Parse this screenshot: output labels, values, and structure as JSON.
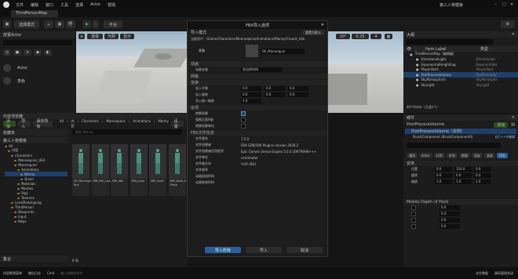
{
  "app": {
    "menu": [
      "文件",
      "编辑",
      "窗口",
      "工具",
      "选择",
      "Actor",
      "帮助"
    ],
    "project": "第三人称模板",
    "tab": "ThirdPersonMap"
  },
  "toolbar": {
    "save": "选择模式",
    "platforms": "平台"
  },
  "viewport_left": {
    "perspective": "透视",
    "lit": "光照",
    "show": "显示"
  },
  "viewport_right": {
    "n1": "10°",
    "n2": "0.25",
    "n3": "4"
  },
  "place_actors": {
    "title": "放置Actor",
    "search_placeholder": "搜索类",
    "items": [
      "Actor",
      "角色"
    ]
  },
  "content_browser": {
    "title": "内容浏览器",
    "add": "添加",
    "import": "导入",
    "save_all": "保存所有",
    "path": [
      "All",
      "内容",
      "Characters",
      "Mannequins",
      "Animations",
      "Manny"
    ],
    "settings": "设置",
    "search_placeholder": "搜索 Manny",
    "favorites": "收藏夹",
    "project": "第三人称模板",
    "tree": [
      "All",
      "内容",
      "Characters",
      "Mannequins_UE4",
      "Mannequins",
      "Animations",
      "Manny",
      "Quinn",
      "Materials",
      "Meshes",
      "Rigs",
      "Textures",
      "LevelPrototyping",
      "ThirdPerson",
      "Blueprints",
      "Input",
      "Maps"
    ],
    "collections": "集合",
    "count": "6 项",
    "assets": [
      "SK_Mannequin_Walk\nRun",
      "MM_Fall_Loop",
      "MM_Idle",
      "MM_Jump",
      "MM_Land",
      "MM_Walk_In\nPlace"
    ]
  },
  "dialog": {
    "title": "FBX导入选项",
    "section_import": "导入模式",
    "reset": "重置为默认",
    "current_asset_label": "当前资产：",
    "current_asset": "/Game/Characters/Mannequins/Animations/Manny/Crouch_Idle",
    "skeleton_label": "骨骼",
    "skeleton_value": "SK_Mannequin",
    "sec_anim": "动画",
    "anim_length_label": "动画长度",
    "anim_length_value": "导出的时间",
    "sec_mesh": "网格",
    "sec_transform": "变换",
    "t1": "导入平移",
    "t2": "导入旋转",
    "t3": "导入统一缩放",
    "v0": "0.0",
    "v1": "1.0",
    "sec_misc": "杂项",
    "m1": "转换场景",
    "m2": "强制正面X轴",
    "m3": "转换场景单位",
    "sec_info": "FBX文件信息",
    "i_ver": "文件版本",
    "i_ver_v": "7.5.0",
    "i_app": "文件创建者",
    "i_app_v": "FBX SDK/FBX Plugins version 2020.2",
    "i_creator": "文件创建者应用程序",
    "i_creator_v": "Epic Games Unreal Engine 5.0.3-20979098+++",
    "i_unit": "文件单位",
    "i_unit_v": "centimeter",
    "i_axis": "文件轴方向",
    "i_axis_v": "Y-UP (RH)",
    "i_time": "文件帧率",
    "i_start": "动画起始时间",
    "i_end": "动画结束时间",
    "import_all": "导入所有",
    "import": "导入",
    "cancel": "取消"
  },
  "outliner": {
    "title": "大纲",
    "col_label": "Item Label",
    "col_type": "类型",
    "rows": [
      {
        "label": "ThirdPersonMap（编辑器）",
        "type": ""
      },
      {
        "label": "DirectionalLight",
        "type": "DirectionalLi"
      },
      {
        "label": "ExponentialHeightFog",
        "type": "ExponentialH"
      },
      {
        "label": "PlayerStart",
        "type": "PlayerStart"
      },
      {
        "label": "PostProcessVolume",
        "type": "PostProcessV"
      },
      {
        "label": "SkyAtmosphere",
        "type": "SkyAtmosphe"
      },
      {
        "label": "SkyLight",
        "type": "SkyLight"
      }
    ],
    "count": "40个Actor（已选1个）"
  },
  "details": {
    "title": "细节",
    "close": "×",
    "object": "PostProcessVolume",
    "add": "添加",
    "selected": "PostProcessVolume（实例）",
    "component": "BrushComponent (BrushComponent0)",
    "edit_cpp": "在C++中编辑",
    "search_placeholder": "搜索",
    "cats": [
      "通用",
      "Actor",
      "LOD",
      "杂项",
      "物理",
      "渲染",
      "流送",
      "所有"
    ],
    "transform": "变换",
    "loc": "位置",
    "rot": "旋转",
    "scale": "缩放",
    "loc_v": [
      "0.0",
      "150.0",
      "0.0"
    ],
    "rot_v": [
      "0.0",
      "0.0",
      "0.0"
    ],
    "scale_v": [
      "1.0",
      "1.0",
      "1.0"
    ],
    "mobile": "Mobile Depth of Field",
    "vals": [
      "0.0",
      "0.0",
      "0.0",
      "0.0"
    ]
  },
  "statusbar": {
    "drawer": "内容侧滑菜单",
    "log": "输出日志",
    "cmd": "Cmd",
    "console": "输入控制台命令",
    "derived": "派生数据",
    "source": "源码管理关闭"
  }
}
